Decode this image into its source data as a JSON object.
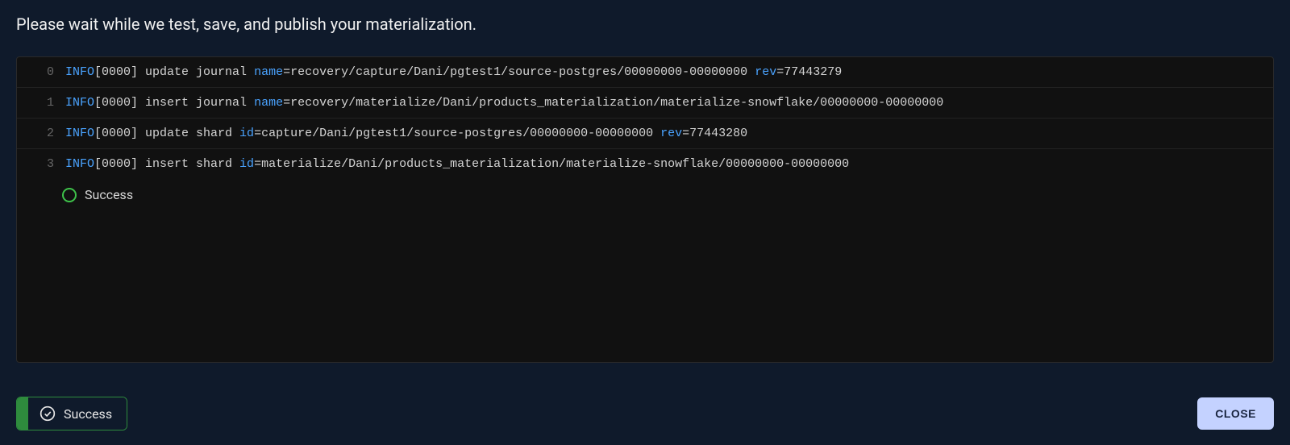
{
  "heading": "Please wait while we test, save, and publish your materialization.",
  "log": {
    "lines": [
      {
        "n": "0",
        "level": "INFO",
        "bracket": "[0000]",
        "action": "update journal",
        "params": [
          {
            "k": "name",
            "v": "recovery/capture/Dani/pgtest1/source-postgres/00000000-00000000"
          },
          {
            "k": "rev",
            "v": "77443279"
          }
        ]
      },
      {
        "n": "1",
        "level": "INFO",
        "bracket": "[0000]",
        "action": "insert journal",
        "params": [
          {
            "k": "name",
            "v": "recovery/materialize/Dani/products_materialization/materialize-snowflake/00000000-00000000"
          }
        ]
      },
      {
        "n": "2",
        "level": "INFO",
        "bracket": "[0000]",
        "action": "update shard",
        "params": [
          {
            "k": "id",
            "v": "capture/Dani/pgtest1/source-postgres/00000000-00000000"
          },
          {
            "k": "rev",
            "v": "77443280"
          }
        ]
      },
      {
        "n": "3",
        "level": "INFO",
        "bracket": "[0000]",
        "action": "insert shard",
        "params": [
          {
            "k": "id",
            "v": "materialize/Dani/products_materialization/materialize-snowflake/00000000-00000000"
          }
        ]
      }
    ],
    "status_text": "Success"
  },
  "footer": {
    "badge_label": "Success",
    "close_label": "CLOSE"
  }
}
